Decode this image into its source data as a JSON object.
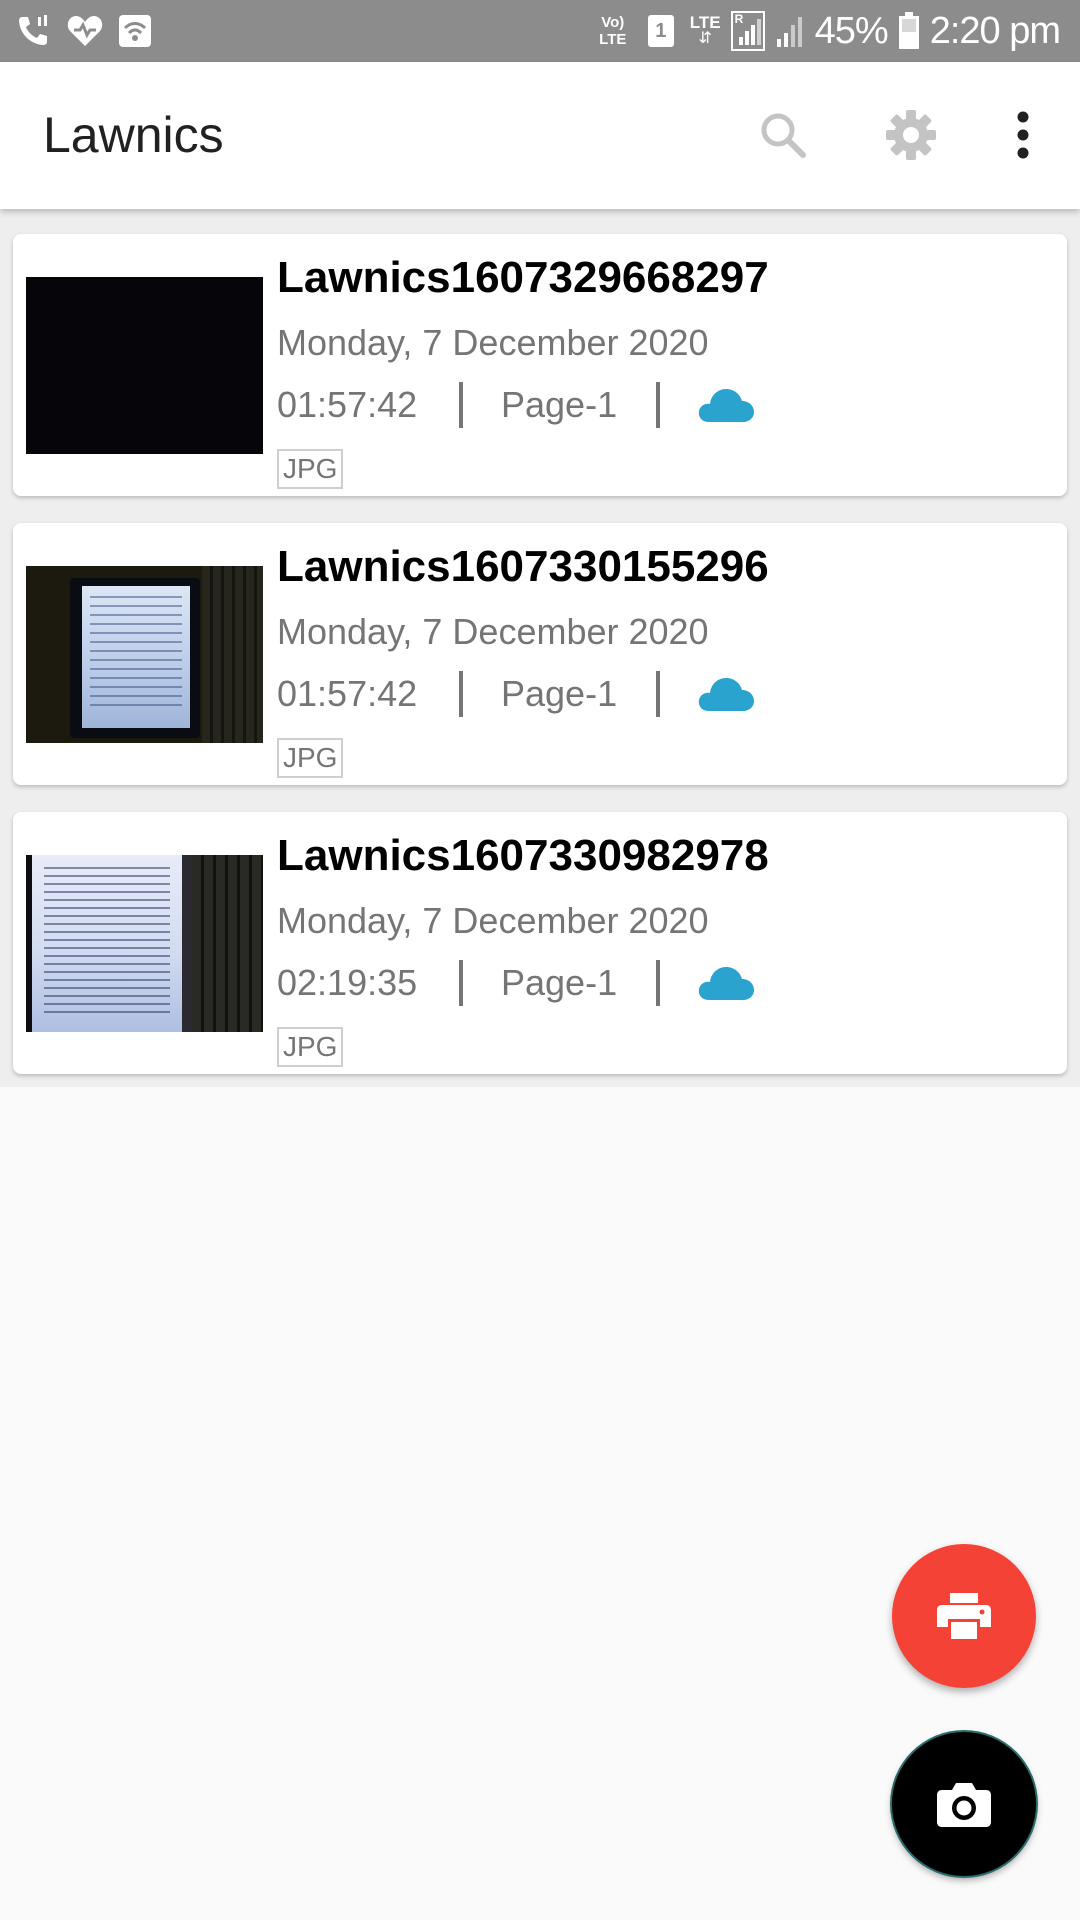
{
  "status_bar": {
    "left_icons": [
      "phone-wifi-call-icon",
      "heart-icon",
      "wifi-icon"
    ],
    "volte_label": "Vo) LTE",
    "sim_label": "1",
    "lte_label": "LTE",
    "roaming_label": "R",
    "battery_percent": "45%",
    "time": "2:20 pm"
  },
  "app_bar": {
    "title": "Lawnics",
    "icons": [
      "search-icon",
      "settings-icon",
      "more-vert-icon"
    ]
  },
  "documents": [
    {
      "name": "Lawnics1607329668297",
      "date": "Monday, 7 December 2020",
      "time": "01:57:42",
      "pages": "Page-1",
      "format": "JPG",
      "synced": true,
      "thumbnail": "dark-photo"
    },
    {
      "name": "Lawnics1607330155296",
      "date": "Monday, 7 December 2020",
      "time": "01:57:42",
      "pages": "Page-1",
      "format": "JPG",
      "synced": true,
      "thumbnail": "laptop-screen-photo"
    },
    {
      "name": "Lawnics1607330982978",
      "date": "Monday, 7 December 2020",
      "time": "02:19:35",
      "pages": "Page-1",
      "format": "JPG",
      "synced": true,
      "thumbnail": "document-screen-photo"
    }
  ],
  "fabs": {
    "print_icon": "print-icon",
    "camera_icon": "camera-icon"
  },
  "colors": {
    "status_bar": "#8c8c8c",
    "cloud": "#2aa3cf",
    "fab_print": "#f44336",
    "fab_camera": "#000000",
    "text_primary": "#000000",
    "text_secondary": "#757575"
  }
}
